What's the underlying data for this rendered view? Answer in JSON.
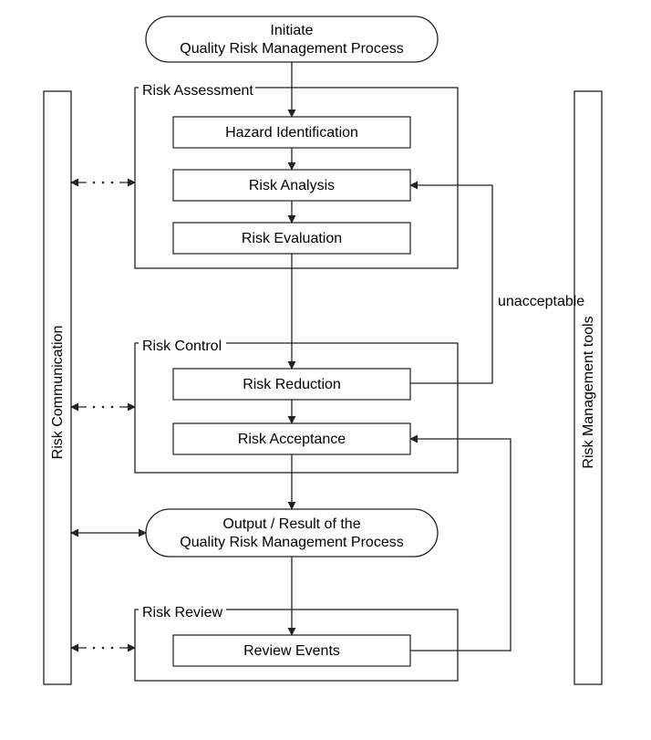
{
  "initiate": {
    "line1": "Initiate",
    "line2": "Quality Risk Management Process"
  },
  "assessment": {
    "title": "Risk Assessment",
    "hazard": "Hazard Identification",
    "analysis": "Risk Analysis",
    "evaluation": "Risk Evaluation"
  },
  "control": {
    "title": "Risk Control",
    "reduction": "Risk Reduction",
    "acceptance": "Risk Acceptance"
  },
  "output": {
    "line1": "Output / Result of the",
    "line2": "Quality Risk Management Process"
  },
  "review": {
    "title": "Risk Review",
    "events": "Review Events"
  },
  "sidebars": {
    "left": "Risk Communication",
    "right": "Risk Management tools"
  },
  "labels": {
    "unacceptable": "unacceptable"
  }
}
